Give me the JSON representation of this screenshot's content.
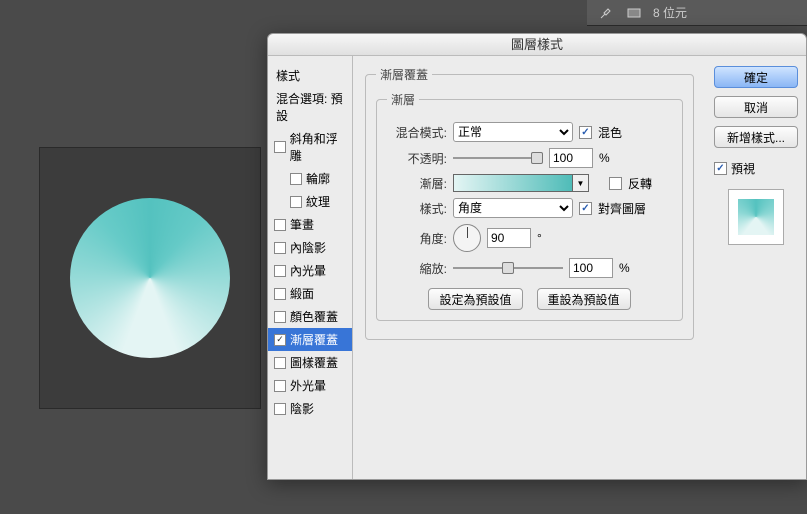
{
  "toolbar": {
    "bits_label": "8 位元"
  },
  "dialog": {
    "title": "圖層樣式",
    "style_header": "樣式",
    "blend_options": "混合選項: 預設",
    "items": [
      {
        "label": "斜角和浮雕",
        "checked": false,
        "sub": false
      },
      {
        "label": "輪廓",
        "checked": false,
        "sub": true
      },
      {
        "label": "紋理",
        "checked": false,
        "sub": true
      },
      {
        "label": "筆畫",
        "checked": false,
        "sub": false
      },
      {
        "label": "內陰影",
        "checked": false,
        "sub": false
      },
      {
        "label": "內光暈",
        "checked": false,
        "sub": false
      },
      {
        "label": "緞面",
        "checked": false,
        "sub": false
      },
      {
        "label": "顏色覆蓋",
        "checked": false,
        "sub": false
      },
      {
        "label": "漸層覆蓋",
        "checked": true,
        "sub": false,
        "selected": true
      },
      {
        "label": "圖樣覆蓋",
        "checked": false,
        "sub": false
      },
      {
        "label": "外光暈",
        "checked": false,
        "sub": false
      },
      {
        "label": "陰影",
        "checked": false,
        "sub": false
      }
    ]
  },
  "gradient_overlay": {
    "section_title": "漸層覆蓋",
    "group_title": "漸層",
    "blend_mode_label": "混合模式:",
    "blend_mode_value": "正常",
    "dither_label": "混色",
    "dither_checked": true,
    "opacity_label": "不透明:",
    "opacity_value": "100",
    "percent": "%",
    "gradient_label": "漸層:",
    "reverse_label": "反轉",
    "reverse_checked": false,
    "style_label": "樣式:",
    "style_value": "角度",
    "align_label": "對齊圖層",
    "align_checked": true,
    "angle_label": "角度:",
    "angle_value": "90",
    "degree": "°",
    "scale_label": "縮放:",
    "scale_value": "100",
    "make_default": "設定為預設值",
    "reset_default": "重設為預設值"
  },
  "buttons": {
    "ok": "確定",
    "cancel": "取消",
    "new_style": "新增樣式...",
    "preview": "預視"
  }
}
